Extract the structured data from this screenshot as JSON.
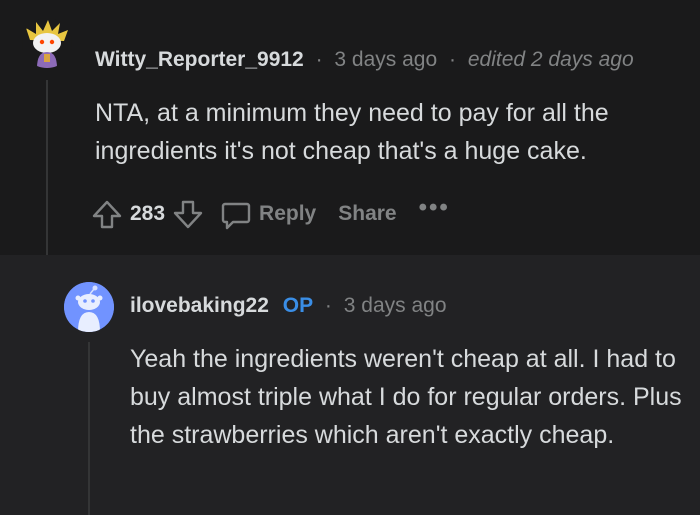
{
  "comments": [
    {
      "author": "Witty_Reporter_9912",
      "time": "3 days ago",
      "edited": "edited 2 days ago",
      "body": "NTA, at a minimum they need to pay for all the ingredients it's not cheap that's a huge cake.",
      "score": "283",
      "actions": {
        "reply": "Reply",
        "share": "Share",
        "more": "•••"
      },
      "avatar_icon": "snoo-avatar-gold-hair"
    },
    {
      "author": "ilovebaking22",
      "op_badge": "OP",
      "time": "3 days ago",
      "body": "Yeah the ingredients weren't cheap at all. I had to buy almost triple what I do for regular orders. Plus the strawberries which aren't exactly cheap.",
      "avatar_icon": "default-snoo-avatar"
    }
  ],
  "separator": "·",
  "colors": {
    "background": "#1a1a1b",
    "reply_background": "#222224",
    "text": "#d7dadc",
    "muted": "#818384",
    "op": "#3a8ee6",
    "avatar_blue": "#7193ff"
  }
}
